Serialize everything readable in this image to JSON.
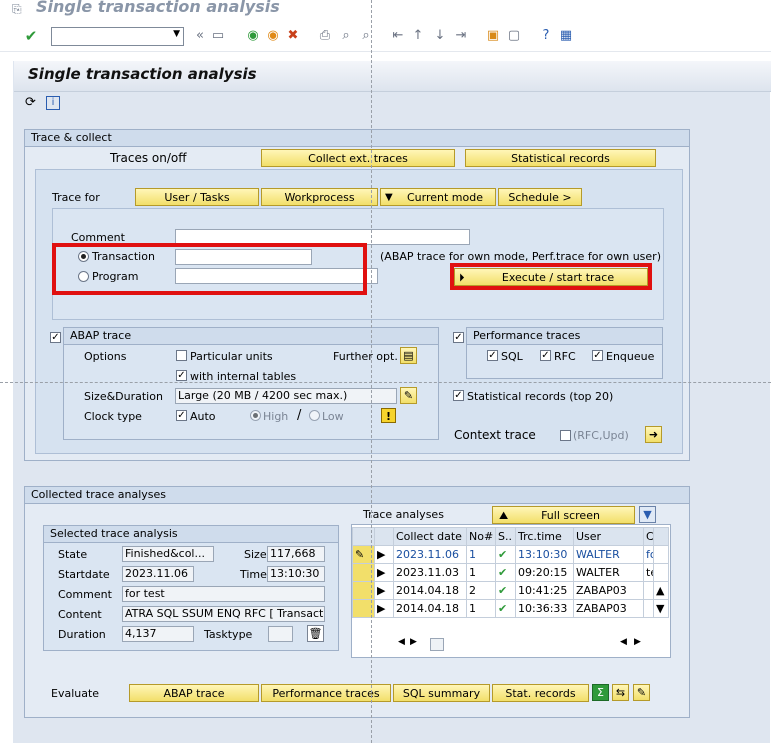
{
  "window": {
    "title": "Single transaction analysis"
  },
  "page": {
    "title": "Single transaction analysis"
  },
  "trace_collect": {
    "title": "Trace & collect",
    "traces_label": "Traces on/off",
    "collect_btn": "Collect ext. traces",
    "stat_btn": "Statistical records",
    "trace_for": "Trace for",
    "tabs": [
      "User / Tasks",
      "Workprocess",
      "Current mode",
      "Schedule >"
    ],
    "comment_label": "Comment",
    "transaction_label": "Transaction",
    "program_label": "Program",
    "note": "(ABAP trace for own mode, Perf.trace for own user)",
    "execute_btn": "Execute / start trace",
    "abap": {
      "title": "ABAP trace",
      "options": "Options",
      "particular": "Particular units",
      "further": "Further opt.",
      "internal": "with internal tables",
      "size_label": "Size&Duration",
      "size_value": "Large (20 MB / 4200 sec max.)",
      "clock_label": "Clock type",
      "auto": "Auto",
      "high": "High",
      "slash": "/",
      "low": "Low"
    },
    "perf": {
      "title": "Performance traces",
      "sql": "SQL",
      "rfc": "RFC",
      "enqueue": "Enqueue"
    },
    "stat_records": "Statistical records (top 20)",
    "context": "Context trace",
    "context_opt": "(RFC,Upd)"
  },
  "collected": {
    "title": "Collected trace analyses",
    "selected": {
      "title": "Selected trace analysis",
      "state_label": "State",
      "state": "Finished&col...",
      "size_label": "Size",
      "size": "117,668",
      "startdate_label": "Startdate",
      "startdate": "2023.11.06",
      "time_label": "Time",
      "time": "13:10:30",
      "comment_label": "Comment",
      "comment": "for test",
      "content_label": "Content",
      "content": "ATRA SQL SSUM ENQ RFC [ Transact...",
      "duration_label": "Duration",
      "duration": "4,137",
      "tasktype_label": "Tasktype",
      "tasktype": ""
    },
    "analyses_label": "Trace analyses",
    "full_screen": "Full screen",
    "columns": [
      "Collect date",
      "No#",
      "S..",
      "Trc.time",
      "User",
      "C"
    ],
    "rows": [
      {
        "date": "2023.11.06",
        "no": "1",
        "time": "13:10:30",
        "user": "WALTER",
        "c": "fo"
      },
      {
        "date": "2023.11.03",
        "no": "1",
        "time": "09:20:15",
        "user": "WALTER",
        "c": "te"
      },
      {
        "date": "2014.04.18",
        "no": "2",
        "time": "10:41:25",
        "user": "ZABAP03",
        "c": ""
      },
      {
        "date": "2014.04.18",
        "no": "1",
        "time": "10:36:33",
        "user": "ZABAP03",
        "c": ""
      }
    ]
  },
  "evaluate": {
    "label": "Evaluate",
    "buttons": [
      "ABAP trace",
      "Performance traces",
      "SQL summary",
      "Stat. records"
    ]
  }
}
